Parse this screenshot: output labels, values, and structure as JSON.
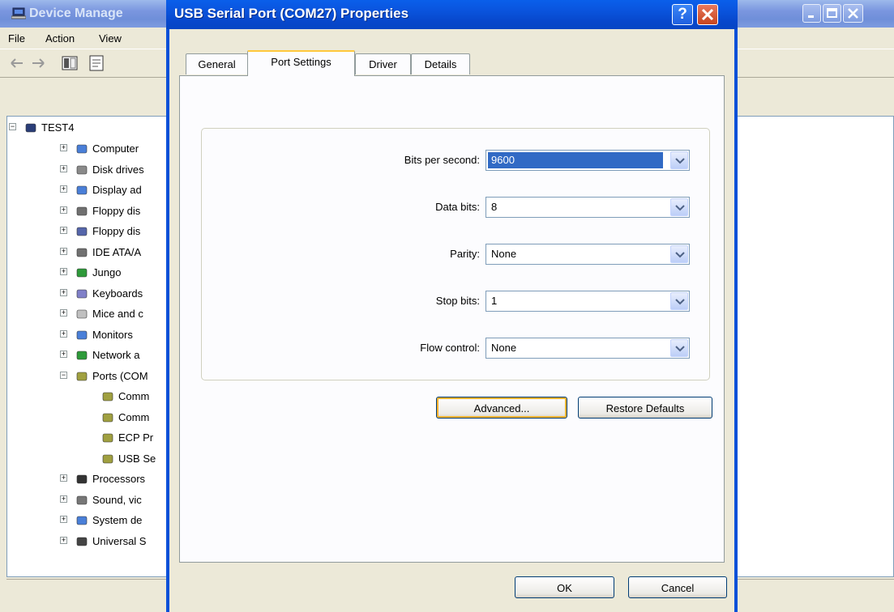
{
  "device_manager": {
    "title": "Device Manage",
    "menu": [
      "File",
      "Action",
      "View"
    ],
    "tree": {
      "root": "TEST4",
      "items": [
        {
          "label": "Computer",
          "expanded": false
        },
        {
          "label": "Disk drives",
          "expanded": false
        },
        {
          "label": "Display ad",
          "expanded": false
        },
        {
          "label": "Floppy dis",
          "expanded": false
        },
        {
          "label": "Floppy dis",
          "expanded": false
        },
        {
          "label": "IDE ATA/A",
          "expanded": false
        },
        {
          "label": "Jungo",
          "expanded": false
        },
        {
          "label": "Keyboards",
          "expanded": false
        },
        {
          "label": "Mice and c",
          "expanded": false
        },
        {
          "label": "Monitors",
          "expanded": false
        },
        {
          "label": "Network a",
          "expanded": false
        },
        {
          "label": "Ports (COM",
          "expanded": true
        },
        {
          "label": "Comm",
          "child": true
        },
        {
          "label": "Comm",
          "child": true
        },
        {
          "label": "ECP Pr",
          "child": true
        },
        {
          "label": "USB Se",
          "child": true
        },
        {
          "label": "Processors",
          "expanded": false
        },
        {
          "label": "Sound, vic",
          "expanded": false
        },
        {
          "label": "System de",
          "expanded": false
        },
        {
          "label": "Universal S",
          "expanded": false
        }
      ]
    }
  },
  "dialog": {
    "title": "USB Serial Port (COM27) Properties",
    "help_glyph": "?",
    "tabs": [
      {
        "label": "General",
        "active": false
      },
      {
        "label": "Port Settings",
        "active": true
      },
      {
        "label": "Driver",
        "active": false
      },
      {
        "label": "Details",
        "active": false
      }
    ],
    "fields": [
      {
        "label": "Bits per second:",
        "value": "9600",
        "selected": true
      },
      {
        "label": "Data bits:",
        "value": "8",
        "selected": false
      },
      {
        "label": "Parity:",
        "value": "None",
        "selected": false
      },
      {
        "label": "Stop bits:",
        "value": "1",
        "selected": false
      },
      {
        "label": "Flow control:",
        "value": "None",
        "selected": false
      }
    ],
    "buttons": {
      "advanced": "Advanced...",
      "restore_defaults": "Restore Defaults",
      "ok": "OK",
      "cancel": "Cancel"
    }
  },
  "colors": {
    "dialog_title_bar": "#0A56E0",
    "inactive_title_bar": "#7A96DF",
    "selection": "#316AC5",
    "dialog_face": "#ECE9D8"
  }
}
